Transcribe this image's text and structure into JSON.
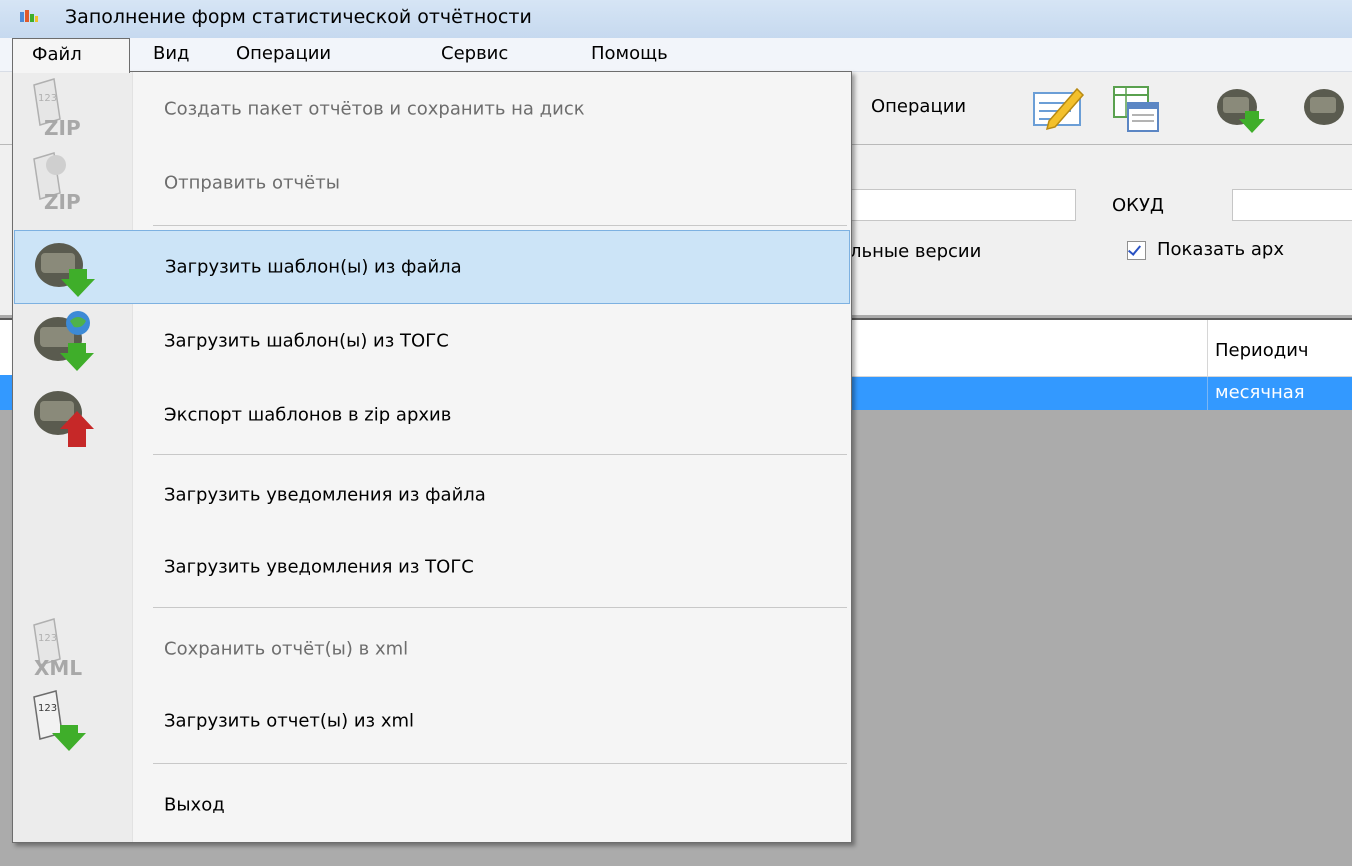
{
  "window": {
    "title": "Заполнение форм статистической отчётности"
  },
  "menubar": {
    "items": [
      "Файл",
      "Вид",
      "Операции",
      "Сервис",
      "Помощь"
    ]
  },
  "toolbar": {
    "operations_label": "Операции",
    "icons": [
      "edit-form-icon",
      "table-icon",
      "load-template-icon",
      "load-template-togs-icon"
    ]
  },
  "filters": {
    "okud_label": "ОКУД",
    "okud_value": "",
    "versions_label": "льные версии",
    "show_archive_label": "Показать арх",
    "show_archive_checked": true
  },
  "grid": {
    "header_periodicity": "Периодич",
    "rows": [
      {
        "periodicity": "месячная"
      }
    ]
  },
  "file_menu": {
    "items": [
      {
        "label": "Создать пакет отчётов и сохранить на диск",
        "icon": "zip-package-icon",
        "disabled": true
      },
      {
        "label": "Отправить отчёты",
        "icon": "zip-send-icon",
        "disabled": true
      },
      {
        "label": "Загрузить шаблон(ы) из файла",
        "icon": "load-template-file-icon",
        "disabled": false,
        "hover": true
      },
      {
        "label": "Загрузить шаблон(ы) из ТОГС",
        "icon": "load-template-togs-icon",
        "disabled": false
      },
      {
        "label": "Экспорт шаблонов в zip архив",
        "icon": "export-templates-icon",
        "disabled": false
      },
      {
        "label": "Загрузить уведомления из файла",
        "icon": "",
        "disabled": false
      },
      {
        "label": "Загрузить уведомления из ТОГС",
        "icon": "",
        "disabled": false
      },
      {
        "label": "Сохранить отчёт(ы) в xml",
        "icon": "xml-save-icon",
        "disabled": true
      },
      {
        "label": "Загрузить отчет(ы) из xml",
        "icon": "xml-load-icon",
        "disabled": false
      },
      {
        "label": "Выход",
        "icon": "",
        "disabled": false
      }
    ],
    "zip_text": "ZIP",
    "xml_text": "XML",
    "digits_text": "123"
  },
  "colors": {
    "hover_bg": "#cce4f7",
    "hover_border": "#7db1e1",
    "selection": "#3399ff",
    "arrow_green": "#3fae2a",
    "arrow_red": "#c62828"
  }
}
